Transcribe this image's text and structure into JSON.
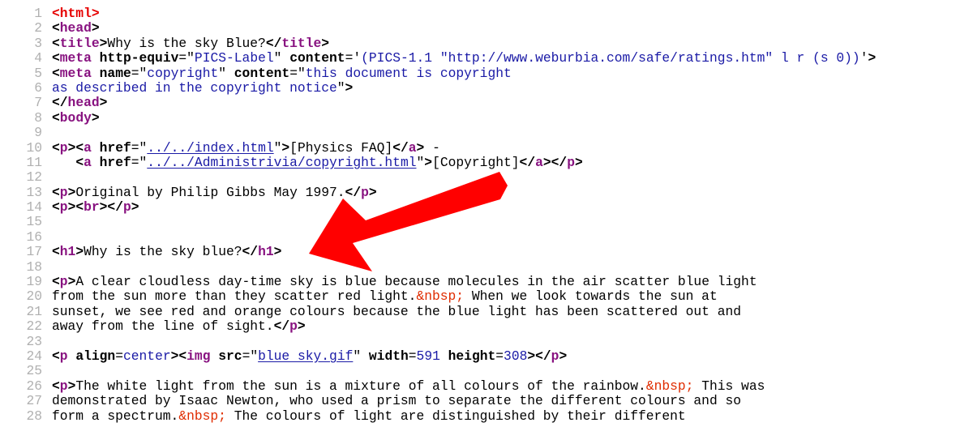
{
  "viewer": {
    "type": "view-source",
    "accent_colors": {
      "root_tag": "#e60000",
      "tag": "#881280",
      "attribute_value": "#1a1aa6",
      "entity": "#e02c00",
      "line_number": "#b0b0b0",
      "annotation_arrow": "#ff0000"
    }
  },
  "annotation": {
    "type": "arrow",
    "color": "#ff0000",
    "points_to": "line 17: <h1>Why is the sky blue?</h1>"
  },
  "lines": [
    {
      "n": "1",
      "tokens": [
        [
          "tag-root",
          "<html>"
        ]
      ]
    },
    {
      "n": "2",
      "tokens": [
        [
          "punct",
          "<"
        ],
        [
          "tag",
          "head"
        ],
        [
          "punct",
          ">"
        ]
      ]
    },
    {
      "n": "3",
      "tokens": [
        [
          "punct",
          "<"
        ],
        [
          "tag",
          "title"
        ],
        [
          "punct",
          ">"
        ],
        [
          "txt",
          "Why is the sky Blue?"
        ],
        [
          "punct",
          "</"
        ],
        [
          "tag",
          "title"
        ],
        [
          "punct",
          ">"
        ]
      ]
    },
    {
      "n": "4",
      "tokens": [
        [
          "punct",
          "<"
        ],
        [
          "tag",
          "meta"
        ],
        [
          "txt",
          " "
        ],
        [
          "attr",
          "http-equiv"
        ],
        [
          "txt",
          "=\""
        ],
        [
          "val",
          "PICS-Label"
        ],
        [
          "txt",
          "\" "
        ],
        [
          "attr",
          "content"
        ],
        [
          "txt",
          "='"
        ],
        [
          "val",
          "(PICS-1.1 \"http://www.weburbia.com/safe/ratings.htm\" l r (s 0))"
        ],
        [
          "txt",
          "'"
        ],
        [
          "punct",
          ">"
        ]
      ]
    },
    {
      "n": "5",
      "tokens": [
        [
          "punct",
          "<"
        ],
        [
          "tag",
          "meta"
        ],
        [
          "txt",
          " "
        ],
        [
          "attr",
          "name"
        ],
        [
          "txt",
          "=\""
        ],
        [
          "val",
          "copyright"
        ],
        [
          "txt",
          "\" "
        ],
        [
          "attr",
          "content"
        ],
        [
          "txt",
          "=\""
        ],
        [
          "val",
          "this document is copyright"
        ]
      ]
    },
    {
      "n": "6",
      "tokens": [
        [
          "val",
          "as described in the copyright notice"
        ],
        [
          "txt",
          "\""
        ],
        [
          "punct",
          ">"
        ]
      ]
    },
    {
      "n": "7",
      "tokens": [
        [
          "punct",
          "</"
        ],
        [
          "tag",
          "head"
        ],
        [
          "punct",
          ">"
        ]
      ]
    },
    {
      "n": "8",
      "tokens": [
        [
          "punct",
          "<"
        ],
        [
          "tag",
          "body"
        ],
        [
          "punct",
          ">"
        ]
      ]
    },
    {
      "n": "9",
      "tokens": []
    },
    {
      "n": "10",
      "tokens": [
        [
          "punct",
          "<"
        ],
        [
          "tag",
          "p"
        ],
        [
          "punct",
          "><"
        ],
        [
          "tag",
          "a"
        ],
        [
          "txt",
          " "
        ],
        [
          "attr",
          "href"
        ],
        [
          "txt",
          "=\""
        ],
        [
          "link",
          "../../index.html"
        ],
        [
          "txt",
          "\""
        ],
        [
          "punct",
          ">"
        ],
        [
          "txt",
          "[Physics FAQ]"
        ],
        [
          "punct",
          "</"
        ],
        [
          "tag",
          "a"
        ],
        [
          "punct",
          ">"
        ],
        [
          "txt",
          " -"
        ]
      ]
    },
    {
      "n": "11",
      "tokens": [
        [
          "txt",
          "   "
        ],
        [
          "punct",
          "<"
        ],
        [
          "tag",
          "a"
        ],
        [
          "txt",
          " "
        ],
        [
          "attr",
          "href"
        ],
        [
          "txt",
          "=\""
        ],
        [
          "link",
          "../../Administrivia/copyright.html"
        ],
        [
          "txt",
          "\""
        ],
        [
          "punct",
          ">"
        ],
        [
          "txt",
          "[Copyright]"
        ],
        [
          "punct",
          "</"
        ],
        [
          "tag",
          "a"
        ],
        [
          "punct",
          "></"
        ],
        [
          "tag",
          "p"
        ],
        [
          "punct",
          ">"
        ]
      ]
    },
    {
      "n": "12",
      "tokens": []
    },
    {
      "n": "13",
      "tokens": [
        [
          "punct",
          "<"
        ],
        [
          "tag",
          "p"
        ],
        [
          "punct",
          ">"
        ],
        [
          "txt",
          "Original by Philip Gibbs May 1997."
        ],
        [
          "punct",
          "</"
        ],
        [
          "tag",
          "p"
        ],
        [
          "punct",
          ">"
        ]
      ]
    },
    {
      "n": "14",
      "tokens": [
        [
          "punct",
          "<"
        ],
        [
          "tag",
          "p"
        ],
        [
          "punct",
          "><"
        ],
        [
          "tag",
          "br"
        ],
        [
          "punct",
          "></"
        ],
        [
          "tag",
          "p"
        ],
        [
          "punct",
          ">"
        ]
      ]
    },
    {
      "n": "15",
      "tokens": []
    },
    {
      "n": "16",
      "tokens": []
    },
    {
      "n": "17",
      "tokens": [
        [
          "punct",
          "<"
        ],
        [
          "tag",
          "h1"
        ],
        [
          "punct",
          ">"
        ],
        [
          "txt",
          "Why is the sky blue?"
        ],
        [
          "punct",
          "</"
        ],
        [
          "tag",
          "h1"
        ],
        [
          "punct",
          ">"
        ]
      ]
    },
    {
      "n": "18",
      "tokens": []
    },
    {
      "n": "19",
      "tokens": [
        [
          "punct",
          "<"
        ],
        [
          "tag",
          "p"
        ],
        [
          "punct",
          ">"
        ],
        [
          "txt",
          "A clear cloudless day-time sky is blue because molecules in the air scatter blue light"
        ]
      ]
    },
    {
      "n": "20",
      "tokens": [
        [
          "txt",
          "from the sun more than they scatter red light."
        ],
        [
          "entity",
          "&nbsp;"
        ],
        [
          "txt",
          " When we look towards the sun at"
        ]
      ]
    },
    {
      "n": "21",
      "tokens": [
        [
          "txt",
          "sunset, we see red and orange colours because the blue light has been scattered out and"
        ]
      ]
    },
    {
      "n": "22",
      "tokens": [
        [
          "txt",
          "away from the line of sight."
        ],
        [
          "punct",
          "</"
        ],
        [
          "tag",
          "p"
        ],
        [
          "punct",
          ">"
        ]
      ]
    },
    {
      "n": "23",
      "tokens": []
    },
    {
      "n": "24",
      "tokens": [
        [
          "punct",
          "<"
        ],
        [
          "tag",
          "p"
        ],
        [
          "txt",
          " "
        ],
        [
          "attr",
          "align"
        ],
        [
          "txt",
          "="
        ],
        [
          "val",
          "center"
        ],
        [
          "punct",
          "><"
        ],
        [
          "tag",
          "img"
        ],
        [
          "txt",
          " "
        ],
        [
          "attr",
          "src"
        ],
        [
          "txt",
          "=\""
        ],
        [
          "link",
          "blue sky.gif"
        ],
        [
          "txt",
          "\" "
        ],
        [
          "attr",
          "width"
        ],
        [
          "txt",
          "="
        ],
        [
          "val",
          "591"
        ],
        [
          "txt",
          " "
        ],
        [
          "attr",
          "height"
        ],
        [
          "txt",
          "="
        ],
        [
          "val",
          "308"
        ],
        [
          "punct",
          "></"
        ],
        [
          "tag",
          "p"
        ],
        [
          "punct",
          ">"
        ]
      ]
    },
    {
      "n": "25",
      "tokens": []
    },
    {
      "n": "26",
      "tokens": [
        [
          "punct",
          "<"
        ],
        [
          "tag",
          "p"
        ],
        [
          "punct",
          ">"
        ],
        [
          "txt",
          "The white light from the sun is a mixture of all colours of the rainbow."
        ],
        [
          "entity",
          "&nbsp;"
        ],
        [
          "txt",
          " This was"
        ]
      ]
    },
    {
      "n": "27",
      "tokens": [
        [
          "txt",
          "demonstrated by Isaac Newton, who used a prism to separate the different colours and so"
        ]
      ]
    },
    {
      "n": "28",
      "tokens": [
        [
          "txt",
          "form a spectrum."
        ],
        [
          "entity",
          "&nbsp;"
        ],
        [
          "txt",
          " The colours of light are distinguished by their different"
        ]
      ]
    }
  ]
}
